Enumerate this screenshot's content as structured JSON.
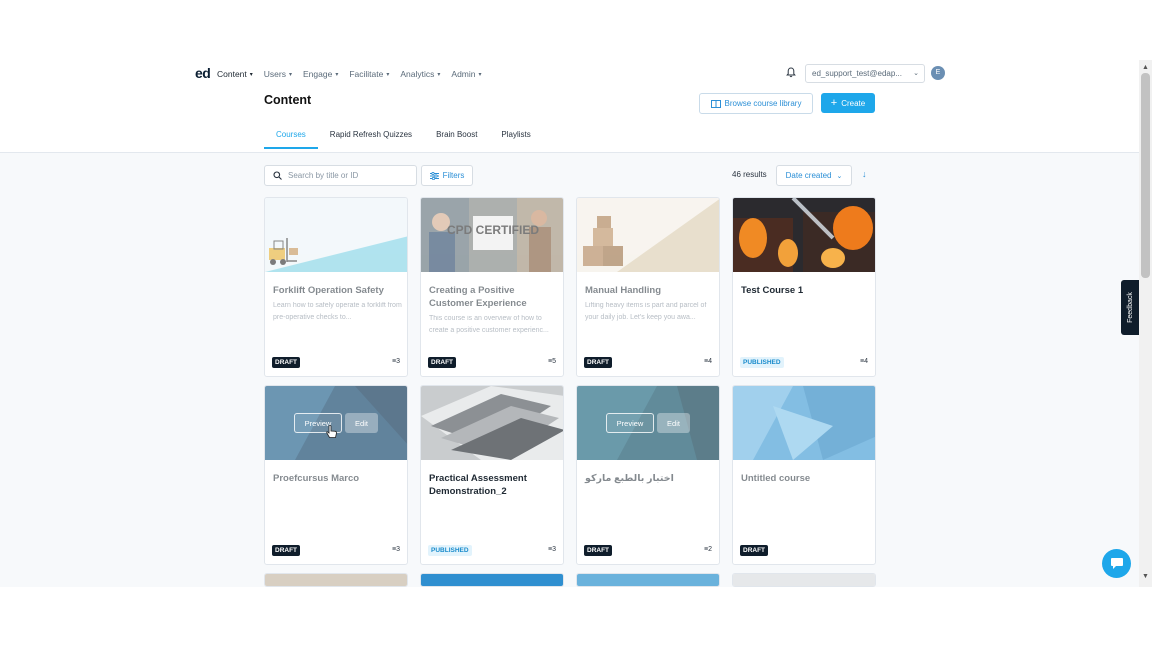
{
  "nav": {
    "logo": "ed",
    "items": [
      {
        "label": "Content",
        "active": true
      },
      {
        "label": "Users",
        "active": false
      },
      {
        "label": "Engage",
        "active": false
      },
      {
        "label": "Facilitate",
        "active": false
      },
      {
        "label": "Analytics",
        "active": false
      },
      {
        "label": "Admin",
        "active": false
      }
    ],
    "user_select": "ed_support_test@edap...",
    "avatar_initial": "E"
  },
  "header": {
    "title": "Content",
    "browse_label": "Browse course library",
    "create_label": "Create"
  },
  "tabs": [
    "Courses",
    "Rapid Refresh Quizzes",
    "Brain Boost",
    "Playlists"
  ],
  "toolbar": {
    "search_placeholder": "Search by title or ID",
    "filters_label": "Filters",
    "results": "46 results",
    "sort_label": "Date created"
  },
  "cards": [
    {
      "title": "Forklift Operation Safety",
      "desc": "Learn how to safely operate a forklift from pre-operative checks to...",
      "status": "DRAFT",
      "count": "3"
    },
    {
      "title": "Creating a Positive Customer Experience",
      "desc": "This course is an overview of how to create a positive customer experienc...",
      "status": "DRAFT",
      "count": "5",
      "thumb_text": "CPD CERTIFIED"
    },
    {
      "title": "Manual Handling",
      "desc": "Lifting heavy items is part and parcel of your daily job. Let's keep you awa...",
      "status": "DRAFT",
      "count": "4"
    },
    {
      "title": "Test Course 1",
      "desc": "",
      "status": "PUBLISHED",
      "count": "4"
    },
    {
      "title": "Proefcursus Marco",
      "desc": "",
      "status": "DRAFT",
      "count": "3",
      "preview_label": "Preview",
      "edit_label": "Edit"
    },
    {
      "title": "Practical Assessment Demonstration_2",
      "desc": "",
      "status": "PUBLISHED",
      "count": "3"
    },
    {
      "title": "اختبار بالطبع ماركو",
      "desc": "",
      "status": "DRAFT",
      "count": "2",
      "preview_label": "Preview",
      "edit_label": "Edit"
    },
    {
      "title": "Untitled course",
      "desc": "",
      "status": "DRAFT",
      "count": ""
    }
  ],
  "feedback_label": "Feedback",
  "colors": {
    "accent": "#1ea7ea",
    "dark": "#0f1d2b"
  }
}
